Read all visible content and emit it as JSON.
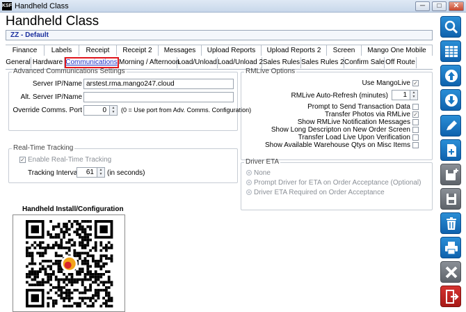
{
  "window": {
    "app_icon_text": "KSF",
    "title": "Handheld Class",
    "controls": {
      "minimize": "─",
      "maximize": "□",
      "close": "✕"
    }
  },
  "header": {
    "title": "Handheld Class",
    "company": "ZZ - Default"
  },
  "tabs_row1": [
    "Finance",
    "Labels",
    "Receipt",
    "Receipt 2",
    "Messages",
    "Upload Reports",
    "Upload Reports 2",
    "Screen",
    "Mango One Mobile"
  ],
  "tabs_row2": [
    "General",
    "Hardware",
    "Communications",
    "Morning / Afternoon",
    "Load/Unload",
    "Load/Unload 2",
    "Sales Rules",
    "Sales Rules 2",
    "Confirm Sale",
    "Off Route"
  ],
  "active_tab": "Communications",
  "advanced_comms": {
    "legend": "Advanced Communications Settings",
    "server_label": "Server IP/Name",
    "server_value": "arstest.rma.mango247.cloud",
    "alt_server_label": "Alt. Server IP/Name",
    "alt_server_value": "",
    "override_label": "Override Comms. Port",
    "override_value": "0",
    "override_hint": "(0 = Use port from Adv. Comms. Configuration)"
  },
  "real_time": {
    "legend": "Real-Time Tracking",
    "enable_label": "Enable Real-Time Tracking",
    "enable_checked": true,
    "interval_label": "Tracking Interval",
    "interval_value": "61",
    "interval_unit": "(in seconds)"
  },
  "rmlive": {
    "legend": "RMLive Options",
    "options": [
      {
        "label": "Use MangoLive",
        "checked": true
      },
      {
        "label": "RMLive Auto-Refresh (minutes)",
        "value": "1"
      },
      {
        "label": "Prompt to Send Transaction Data",
        "checked": false
      },
      {
        "label": "Transfer Photos via RMLive",
        "checked": true
      },
      {
        "label": "Show RMLive Notification Messages",
        "checked": false
      },
      {
        "label": "Show Long Descripton on New Order Screen",
        "checked": false
      },
      {
        "label": "Transfer Load Live Upon Verification",
        "checked": false
      },
      {
        "label": "Show Available Warehouse Qtys on Misc Items",
        "checked": false
      }
    ]
  },
  "driver_eta": {
    "legend": "Driver ETA",
    "options": [
      "None",
      "Prompt Driver for ETA on Order Acceptance (Optional)",
      "Driver ETA Required on Order Acceptance"
    ]
  },
  "install": {
    "label": "Handheld Install/Configuration"
  },
  "sidebar": {
    "icons": [
      "search-icon",
      "grid-icon",
      "arrow-up-icon",
      "arrow-down-icon",
      "edit-icon",
      "new-document-icon",
      "save-as-icon",
      "save-icon",
      "delete-icon",
      "print-icon",
      "cancel-icon",
      "exit-icon"
    ]
  },
  "colors": {
    "active_tab_text": "#1d2fc6",
    "active_tab_outline": "#e0161d",
    "company_text": "#1a2f9e",
    "sidebar_blue": "#1878c4",
    "sidebar_grey": "#6f747b",
    "sidebar_red": "#bf2622"
  }
}
